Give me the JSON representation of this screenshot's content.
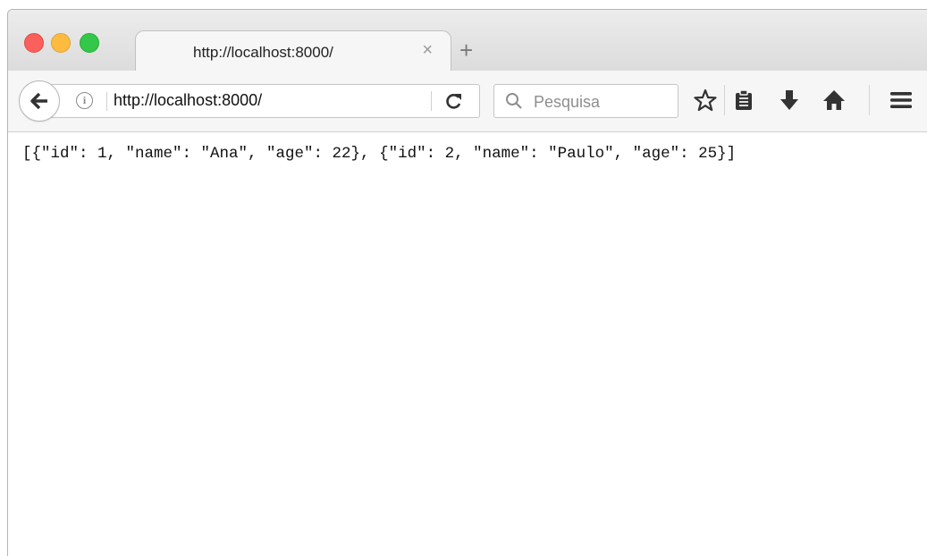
{
  "tab": {
    "title": "http://localhost:8000/",
    "close_glyph": "×"
  },
  "new_tab_glyph": "+",
  "toolbar": {
    "url": "http://localhost:8000/",
    "search_placeholder": "Pesquisa",
    "icons": [
      "back-arrow-icon",
      "info-icon",
      "reload-icon",
      "search-icon",
      "bookmark-star-icon",
      "reading-list-icon",
      "downloads-icon",
      "home-icon",
      "menu-icon"
    ]
  },
  "page": {
    "body_text": "[{\"id\": 1, \"name\": \"Ana\", \"age\": 22}, {\"id\": 2, \"name\": \"Paulo\", \"age\": 25}]"
  },
  "colors": {
    "close": "#fc605c",
    "minimize": "#fdbc40",
    "maximize": "#34c84a"
  }
}
